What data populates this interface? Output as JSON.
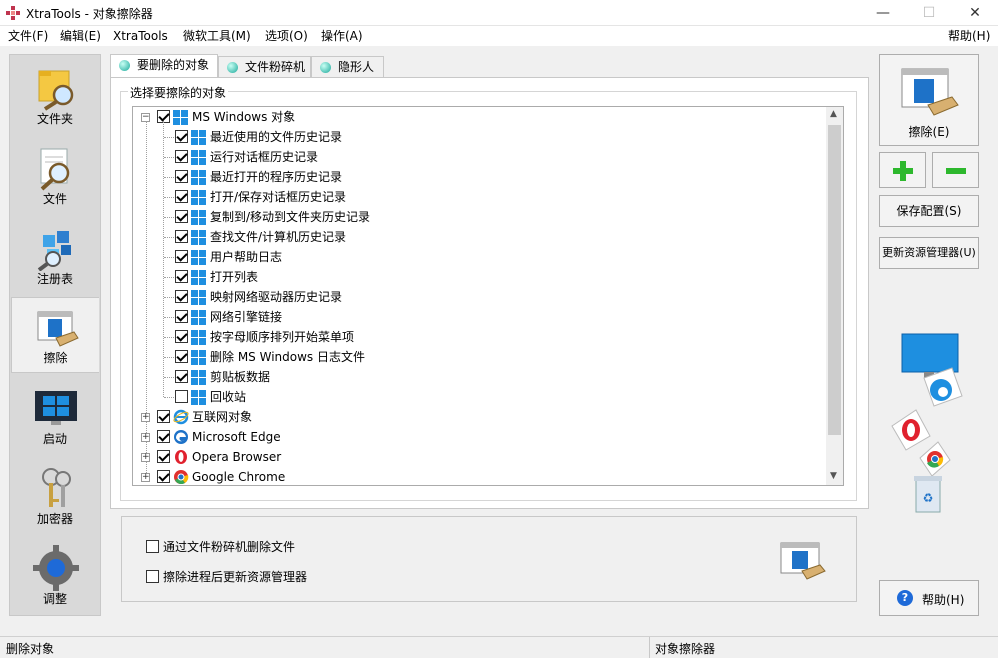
{
  "window": {
    "title": "XtraTools - 对象擦除器",
    "minimize": "—",
    "maximize": "☐",
    "close": "✕"
  },
  "menu": {
    "file": "文件(F)",
    "edit": "编辑(E)",
    "xtratools": "XtraTools",
    "ms_tools": "微软工具(M)",
    "options": "选项(O)",
    "actions": "操作(A)",
    "help": "帮助(H)"
  },
  "nav": [
    {
      "label": "文件夹",
      "icon": "folder-search-icon"
    },
    {
      "label": "文件",
      "icon": "file-search-icon"
    },
    {
      "label": "注册表",
      "icon": "registry-icon"
    },
    {
      "label": "擦除",
      "icon": "eraser-icon",
      "active": true
    },
    {
      "label": "启动",
      "icon": "windows-startup-icon"
    },
    {
      "label": "加密器",
      "icon": "keys-icon"
    },
    {
      "label": "调整",
      "icon": "gear-icon"
    }
  ],
  "tabs": [
    "要删除的对象",
    "文件粉碎机",
    "隐形人"
  ],
  "group_label": "选择要擦除的对象",
  "tree": {
    "root": {
      "label": "MS Windows 对象",
      "checked": true,
      "expanded": true
    },
    "children": [
      {
        "label": "最近使用的文件历史记录",
        "checked": true
      },
      {
        "label": "运行对话框历史记录",
        "checked": true
      },
      {
        "label": "最近打开的程序历史记录",
        "checked": true
      },
      {
        "label": "打开/保存对话框历史记录",
        "checked": true
      },
      {
        "label": "复制到/移动到文件夹历史记录",
        "checked": true
      },
      {
        "label": "查找文件/计算机历史记录",
        "checked": true
      },
      {
        "label": "用户帮助日志",
        "checked": true
      },
      {
        "label": "打开列表",
        "checked": true
      },
      {
        "label": "映射网络驱动器历史记录",
        "checked": true
      },
      {
        "label": "网络引擎链接",
        "checked": true
      },
      {
        "label": "按字母顺序排列开始菜单项",
        "checked": true
      },
      {
        "label": "删除 MS Windows 日志文件",
        "checked": true
      },
      {
        "label": "剪贴板数据",
        "checked": true
      },
      {
        "label": "回收站",
        "checked": false
      }
    ],
    "other_roots": [
      {
        "label": "互联网对象",
        "checked": true,
        "icon": "internet-explorer-icon"
      },
      {
        "label": "Microsoft Edge",
        "checked": true,
        "icon": "edge-icon"
      },
      {
        "label": "Opera Browser",
        "checked": true,
        "icon": "opera-icon"
      },
      {
        "label": "Google Chrome",
        "checked": true,
        "icon": "chrome-icon"
      }
    ]
  },
  "options": {
    "shred_files": "通过文件粉碎机删除文件",
    "refresh_explorer": "擦除进程后更新资源管理器"
  },
  "right_panel": {
    "erase": "擦除(E)",
    "add": "+",
    "remove": "−",
    "save_config": "保存配置(S)",
    "update_explorer": "更新资源管理器(U)",
    "help": "帮助(H)",
    "help_icon": "?"
  },
  "status": {
    "left": "删除对象",
    "right": "对象擦除器"
  },
  "colors": {
    "windows_blue": "#1e8fe0",
    "accent_green": "#2db82d",
    "teal_dot": "#1aa89a"
  }
}
